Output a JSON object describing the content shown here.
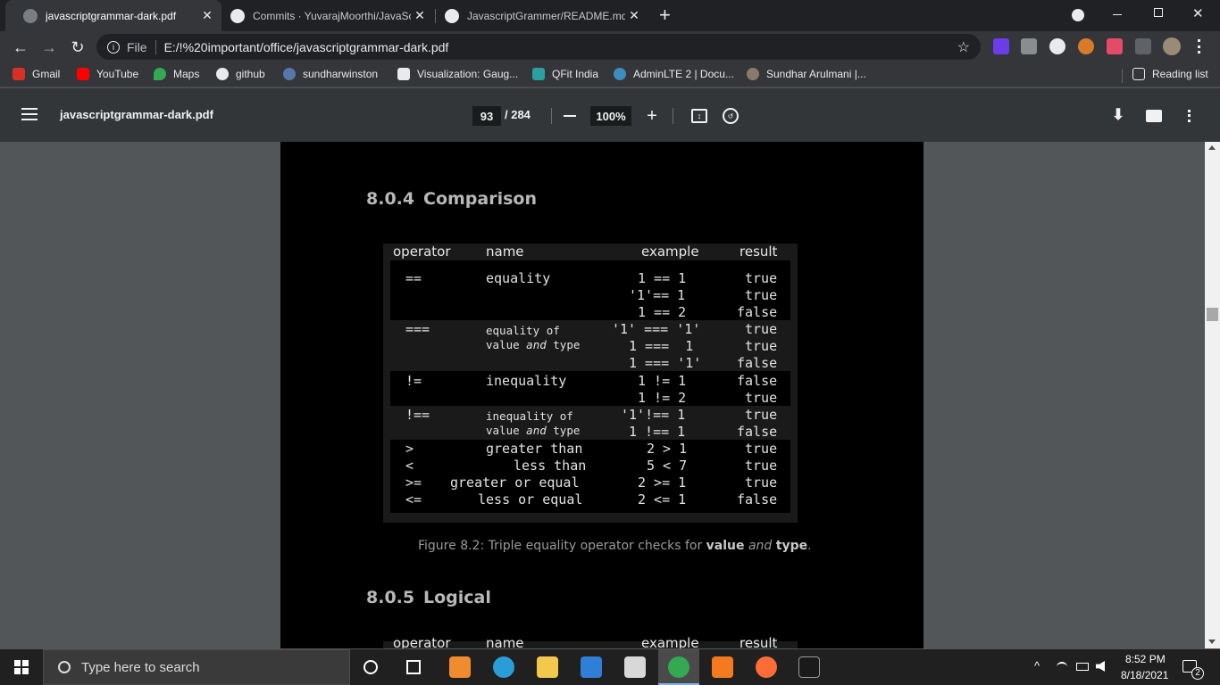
{
  "browser": {
    "tabs": [
      {
        "title": "javascriptgrammar-dark.pdf",
        "active": true
      },
      {
        "title": "Commits · YuvarajMoorthi/JavaScr",
        "active": false
      },
      {
        "title": "JavascriptGrammer/README.md",
        "active": false
      }
    ],
    "close_glyph": "✕",
    "new_tab_glyph": "+",
    "address": {
      "scheme_label": "File",
      "url": "E:/!%20important/office/javascriptgrammar-dark.pdf"
    },
    "bookmarks": [
      "Gmail",
      "YouTube",
      "Maps",
      "github",
      "sundharwinston",
      "Visualization: Gaug...",
      "QFit India",
      "AdminLTE 2 | Docu...",
      "Sundhar Arulmani |..."
    ],
    "reading_list": "Reading list"
  },
  "pdf_toolbar": {
    "filename": "javascriptgrammar-dark.pdf",
    "current_page": "93",
    "total_pages": "/ 284",
    "zoom": "100%"
  },
  "document": {
    "section_comparison": {
      "number": "8.0.4",
      "title": "Comparison"
    },
    "table_headers": [
      "operator",
      "name",
      "example",
      "result"
    ],
    "rows": [
      {
        "op": "==",
        "name": "equality",
        "examples": [
          "1 == 1",
          "'1'== 1",
          "1 == 2"
        ],
        "results": [
          "true",
          "true",
          "false"
        ]
      },
      {
        "op": "===",
        "name_lines": [
          "equality of",
          "value",
          "and",
          "type"
        ],
        "examples": [
          "'1' === '1'",
          "1 ===  1",
          "1 === '1'"
        ],
        "results": [
          "true",
          "true",
          "false"
        ]
      },
      {
        "op": "!=",
        "name": "inequality",
        "examples": [
          "1 != 1",
          "1 != 2"
        ],
        "results": [
          "false",
          "true"
        ]
      },
      {
        "op": "!==",
        "name_lines": [
          "inequality of",
          "value",
          "and",
          "type"
        ],
        "examples": [
          "'1'!== 1",
          "1 !== 1"
        ],
        "results": [
          "true",
          "false"
        ]
      },
      {
        "op": ">",
        "name": "greater than",
        "examples": [
          "2 > 1"
        ],
        "results": [
          "true"
        ]
      },
      {
        "op": "<",
        "name": "less than",
        "examples": [
          "5 < 7"
        ],
        "results": [
          "true"
        ]
      },
      {
        "op": ">=",
        "name": "greater or equal",
        "examples": [
          "2 >= 1"
        ],
        "results": [
          "true"
        ]
      },
      {
        "op": "<=",
        "name": "less or equal",
        "examples": [
          "2 <= 1"
        ],
        "results": [
          "false"
        ]
      }
    ],
    "caption": {
      "prefix": "Figure 8.2:  Triple equality operator checks for ",
      "bold1": "value",
      "mid": " and ",
      "bold2": "type",
      "suffix": "."
    },
    "section_logical": {
      "number": "8.0.5",
      "title": "Logical"
    },
    "next_table_headers": [
      "operator",
      "name",
      "example",
      "result"
    ]
  },
  "taskbar": {
    "search_placeholder": "Type here to search",
    "time": "8:52 PM",
    "date": "8/18/2021",
    "notification_count": "2"
  }
}
